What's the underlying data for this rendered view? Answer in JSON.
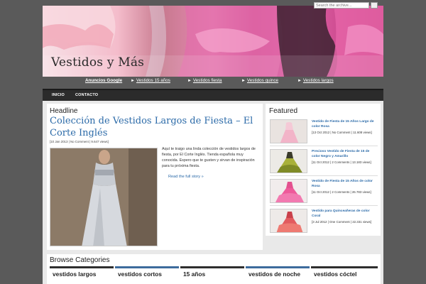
{
  "site": {
    "title": "Vestidos y Más"
  },
  "top_links": {
    "ads_label": "Anuncios Google",
    "items": [
      {
        "label": "Vestidos 15 años"
      },
      {
        "label": "Vestidos fiesta"
      },
      {
        "label": "Vestidos quince"
      },
      {
        "label": "Vestidos largos"
      }
    ]
  },
  "nav": {
    "items": [
      {
        "label": "INICIO"
      },
      {
        "label": "CONTACTO"
      }
    ],
    "search_placeholder": "Search the archive..."
  },
  "headline": {
    "section_label": "Headline",
    "title": "Colección de Vestidos Largos de Fiesta – El Corte Inglés",
    "meta": "[10 Jan 2013 | No Comment | 9.647 views]",
    "excerpt": "Aquí te traigo una linda colección de vestidos largos de fiesta, por El Corte Inglés. Tienda española muy conocida. Espero que te gusten y sirvan de inspiración para tu próxima fiesta.",
    "read_more": "Read the full story »"
  },
  "featured": {
    "section_label": "Featured",
    "items": [
      {
        "title": "Vestido de Fiesta de 15 Años Largo de color Rosa",
        "meta": "[13 Oct 2012 | No Comment | 11.608 views]"
      },
      {
        "title": "Precioso Vestido de Fiesta de 15 de color Negro y Amarillo",
        "meta": "[11 Oct 2012 | 2 Comments | 13.183 views]"
      },
      {
        "title": "Vestido de Fiesta de 15 Años de color Rosa",
        "meta": "[11 Oct 2012 | 2 Comments | 26.783 views]"
      },
      {
        "title": "Vestido para Quinceañeras de color Coral",
        "meta": "[3 Jul 2012 | One Comment | 22.331 views]"
      }
    ]
  },
  "browse": {
    "section_label": "Browse Categories",
    "categories": [
      {
        "label": "vestidos largos"
      },
      {
        "label": "vestidos cortos"
      },
      {
        "label": "15 años"
      },
      {
        "label": "vestidos de noche"
      },
      {
        "label": "vestidos cóctel"
      }
    ]
  },
  "colors": {
    "background": "#5a5a5a",
    "link_blue": "#2b6aa8",
    "nav_bg": "#2b2b2b",
    "strip_dark": "#2e2e2e",
    "strip_blue": "#3d6b9c"
  }
}
